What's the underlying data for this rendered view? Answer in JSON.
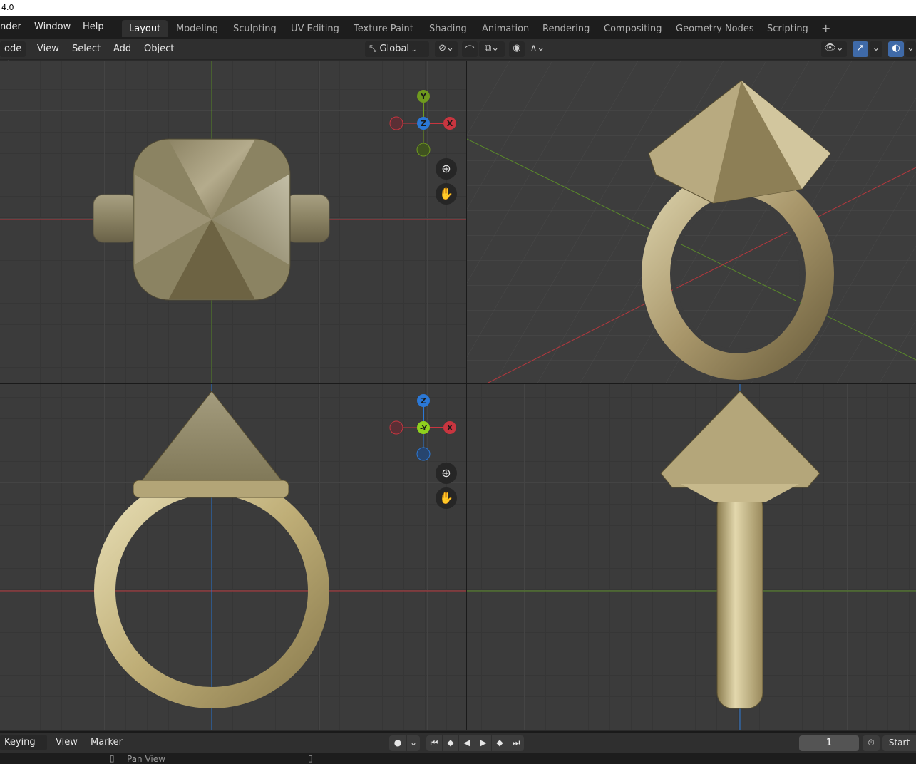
{
  "app": {
    "title_fragment": "4.0"
  },
  "topbar": {
    "menus": [
      "nder",
      "Window",
      "Help"
    ],
    "workspace_tabs": [
      "Layout",
      "Modeling",
      "Sculpting",
      "UV Editing",
      "Texture Paint",
      "Shading",
      "Animation",
      "Rendering",
      "Compositing",
      "Geometry Nodes",
      "Scripting"
    ],
    "active_tab": "Layout",
    "add_tab": "+"
  },
  "viewport_header": {
    "mode": "ode",
    "menus": [
      "View",
      "Select",
      "Add",
      "Object"
    ],
    "orientation": "Global"
  },
  "gizmo_top": {
    "labels": {
      "y": "Y",
      "z": "Z",
      "x": "X"
    }
  },
  "gizmo_front": {
    "labels": {
      "z": "Z",
      "y": "-Y",
      "x": "X"
    }
  },
  "timeline": {
    "keying": "Keying",
    "view": "View",
    "marker": "Marker",
    "current_frame": "1",
    "start_label": "Start"
  },
  "statusbar": {
    "hint": "Pan View"
  },
  "colors": {
    "accent": "#3f6aa8",
    "axis_x": "#c8353f",
    "axis_y": "#6f9a1e",
    "axis_z": "#2b78d6",
    "gold": "#c9b57c"
  },
  "icons": [
    "transform-orientation-icon",
    "pivot-icon",
    "snap-icon",
    "proportional-icon",
    "visibility-icon",
    "gizmo-icon",
    "overlay-icon",
    "zoom-icon",
    "hand-icon",
    "record-icon",
    "jump-start-icon",
    "prev-keyframe-icon",
    "play-reverse-icon",
    "play-icon",
    "next-keyframe-icon",
    "jump-end-icon",
    "stopwatch-icon",
    "mouse-icon"
  ]
}
